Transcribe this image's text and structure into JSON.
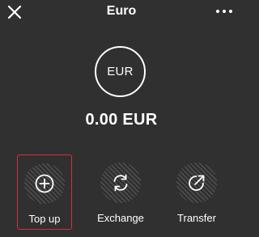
{
  "header": {
    "title": "Euro",
    "close_icon": "close-icon",
    "more_icon": "more-horizontal-icon"
  },
  "account": {
    "currency_code": "EUR",
    "balance": "0.00 EUR"
  },
  "actions": [
    {
      "label": "Top up",
      "icon": "plus-circle-icon",
      "selected": true
    },
    {
      "label": "Exchange",
      "icon": "exchange-arrows-icon",
      "selected": false
    },
    {
      "label": "Transfer",
      "icon": "transfer-arrow-icon",
      "selected": false
    }
  ],
  "colors": {
    "background": "#303030",
    "text": "#ffffff",
    "selection_border": "#d32f3f"
  }
}
